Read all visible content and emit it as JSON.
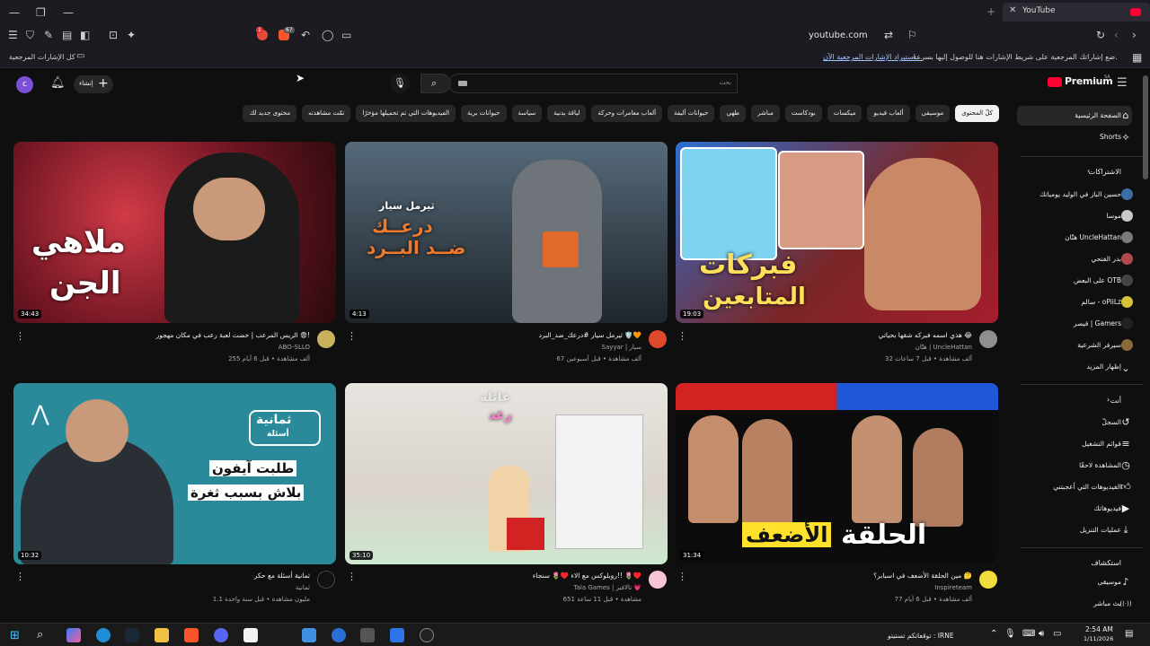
{
  "browser": {
    "tab_title": "YouTube",
    "url": "youtube.com",
    "ext_badge_1": "1",
    "ext_badge_2": "67",
    "bookmarks_hint": "ضع إشاراتك المرجعية على شريط الإشارات هنا للوصول إليها بسرعة.",
    "bookmarks_import": "استيراد الإشارات المرجعية الآن...",
    "all_bookmarks": "كل الإشارات المرجعية"
  },
  "header": {
    "logo": "Premium",
    "logo_region": "SA",
    "search_placeholder": "بحث",
    "create_label": "إنشاء",
    "avatar_letter": "c"
  },
  "chips": [
    "كلّ المحتوى",
    "موسيقى",
    "ألعاب فيديو",
    "ميكسات",
    "بودكاست",
    "مباشر",
    "طهي",
    "حيوانات أليفة",
    "ألعاب مغامرات وحركة",
    "لياقة بدنية",
    "سياسة",
    "حيوانات برية",
    "الفيديوهات التي تم تحميلها مؤخرًا",
    "تمّت مشاهدته",
    "محتوى جديد لك"
  ],
  "sidebar": {
    "home": "الصفحة الرئيسية",
    "shorts": "Shorts",
    "subs_header": "الاشتراكات",
    "subs": [
      {
        "name": "حسين الباز في الوليد يومياتك",
        "color": "#3a6ea5"
      },
      {
        "name": "موسا",
        "color": "#c9c9c9"
      },
      {
        "name": "هتّان UncleHattan",
        "color": "#7a7a7a"
      },
      {
        "name": "بدر الفتحي",
        "color": "#b04a4a"
      },
      {
        "name": "على البعض OTB",
        "color": "#444444"
      },
      {
        "name": "سالم - oPiiLz",
        "color": "#d8c23a"
      },
      {
        "name": "قيصر | Gamers",
        "color": "#222222"
      },
      {
        "name": "سيرفر الشرعية",
        "color": "#8a6a3a"
      }
    ],
    "show_more": "إظهار المزيد",
    "you_header": "أنت",
    "you_items": [
      "السجلّ",
      "قوائم التشغيل",
      "المشاهدة لاحقًا",
      "الفيديوهات التي أعجبتني",
      "فيديوهاتك",
      "عمليات التنزيل"
    ],
    "explore_header": "استكشاف",
    "explore_items": [
      "موسيقى",
      "بث مباشر"
    ]
  },
  "videos": [
    {
      "title": "هذي اسمه فبركه شقها بحياتي 😂",
      "channel": "هتّان | UncleHattan",
      "meta": "32 ألف مشاهدة • قبل 7 ساعات",
      "duration": "19:03",
      "thumb_text_1": "فبركات",
      "thumb_text_2": "المتابعين"
    },
    {
      "title": "ثيرمل سيار #درعك_ضد_البرد 🛡️🧡",
      "channel": "Sayyar | سيار",
      "meta": "67 ألف مشاهدة • قبل أسبوعين",
      "duration": "4:13",
      "thumb_text_1": "درعــك",
      "thumb_text_2": "ضــد البــرد",
      "thumb_text_3": "ثيرمل سيار"
    },
    {
      "title": "الريس المرعب | خضت لعبة رعب في مكان مهجور 😨!",
      "channel": "ABO-SLLO",
      "meta": "255 ألف مشاهدة • قبل 6 أيام",
      "duration": "34:43",
      "thumb_text_1": "ملاهي",
      "thumb_text_2": "الجن"
    },
    {
      "title": "مين الحلقة الأضعف في اسبابر؟ 🤔",
      "channel": "Inspireteam",
      "meta": "77 ألف مشاهدة • قبل 6 أيام",
      "duration": "31:34",
      "thumb_text_1": "الحلقة",
      "thumb_text_2": "الأضعف"
    },
    {
      "title": "روبلوكس مع الاء ♥️🌷 سنجاء!! 🌷♥️",
      "channel": "Tala Games | تالافيز 💗",
      "meta": "651 مشاهدة • قبل 11 ساعة",
      "duration": "35:10",
      "thumb_text_1": "عائلة",
      "thumb_text_2": "رغد"
    },
    {
      "title": "ثمانية أسئلة مع حكر",
      "channel": "ثمانية",
      "meta": "1.1 مليون مشاهدة • قبل سنة واحدة",
      "duration": "10:32",
      "thumb_text_1": "ثمانية",
      "thumb_text_2": "أسئلة",
      "thumb_text_3": "طلبت آيفون",
      "thumb_text_4": "بلاش بسبب ثغرة"
    }
  ],
  "taskbar": {
    "time": "2:54 AM",
    "date": "1/11/2026",
    "news": "توقعاتكم تستيتو : IRNE"
  }
}
